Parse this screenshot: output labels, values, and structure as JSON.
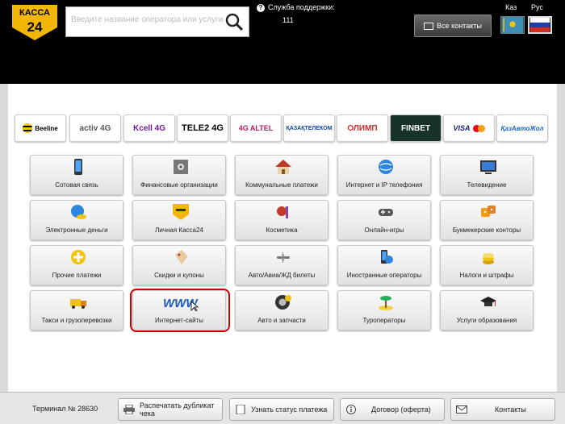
{
  "header": {
    "logo_text_top": "КАССА",
    "logo_text_bottom": "24",
    "search_placeholder": "Введите название оператора или услуги",
    "support_label": "Служба поддержки:",
    "support_phone": "111",
    "contacts_button": "Все контакты",
    "lang_kz": "Каз",
    "lang_ru": "Рус"
  },
  "operators": [
    {
      "label": "Beeline",
      "color": "#000000"
    },
    {
      "label": "activ 4G",
      "color": "#555555"
    },
    {
      "label": "Kcell 4G",
      "color": "#6a1b9a"
    },
    {
      "label": "TELE2 4G",
      "color": "#000000"
    },
    {
      "label": "4G ALTEL",
      "color": "#c2185b"
    },
    {
      "label": "ҚАЗАҚТЕЛЕКОМ",
      "color": "#0d47a1"
    },
    {
      "label": "ОЛИМП",
      "color": "#d32f2f"
    },
    {
      "label": "FINBET",
      "color": "#ffffff"
    },
    {
      "label": "VISA",
      "color": "#1a237e"
    },
    {
      "label": "ҚазАвтоЖол",
      "color": "#1565c0"
    }
  ],
  "categories": [
    {
      "label": "Сотовая связь",
      "icon": "phone-icon"
    },
    {
      "label": "Финансовые организации",
      "icon": "safe-icon"
    },
    {
      "label": "Коммунальные платежи",
      "icon": "house-icon"
    },
    {
      "label": "Интернет и IP телефония",
      "icon": "globe-icon"
    },
    {
      "label": "Телевидение",
      "icon": "tv-icon"
    },
    {
      "label": "Электронные деньги",
      "icon": "globe-coins-icon"
    },
    {
      "label": "Личная Касса24",
      "icon": "kassa24-icon"
    },
    {
      "label": "Косметика",
      "icon": "cosmetics-icon"
    },
    {
      "label": "Онлайн-игры",
      "icon": "gamepad-icon"
    },
    {
      "label": "Букмекерские конторы",
      "icon": "dice-icon"
    },
    {
      "label": "Прочие платежи",
      "icon": "plus-icon"
    },
    {
      "label": "Скидки и купоны",
      "icon": "tag-icon"
    },
    {
      "label": "Авто/Авиа/ЖД билеты",
      "icon": "plane-icon"
    },
    {
      "label": "Иностранные операторы",
      "icon": "phone-globe-icon"
    },
    {
      "label": "Налоги и штрафы",
      "icon": "coins-icon"
    },
    {
      "label": "Такси и грузоперевозки",
      "icon": "taxi-icon"
    },
    {
      "label": "Интернет-сайты",
      "icon": "www-icon"
    },
    {
      "label": "Авто и запчасти",
      "icon": "wheel-icon"
    },
    {
      "label": "Туроператоры",
      "icon": "island-icon"
    },
    {
      "label": "Услуги образования",
      "icon": "graduation-cap-icon"
    }
  ],
  "footer": {
    "terminal": "Терминал № 28630",
    "print_duplicate": "Распечатать дубликат чека",
    "check_status": "Узнать статус платежа",
    "contract": "Договор (оферта)",
    "contacts": "Контакты"
  }
}
